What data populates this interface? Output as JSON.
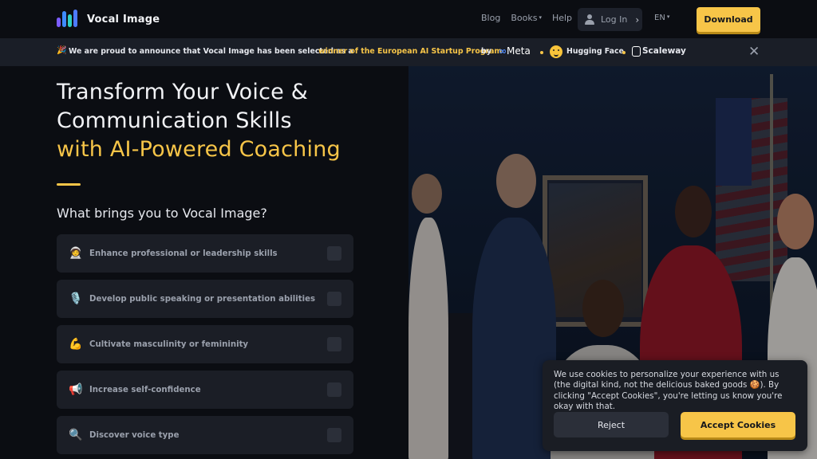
{
  "nav": {
    "logo_text": "Vocal Image",
    "links": [
      {
        "label": "Blog"
      },
      {
        "label": "Books",
        "caret": "▾"
      },
      {
        "label": "Help"
      }
    ],
    "login_label": "Log In",
    "lang_label": "EN",
    "download_label": "Download"
  },
  "banner": {
    "emoji": "🎉",
    "text": "We are proud to announce that Vocal Image has been selected as a",
    "highlight": "winner of the European AI Startup Program",
    "by": "by",
    "partners": [
      "Meta",
      "Hugging Face",
      "Scaleway"
    ],
    "close": "✕"
  },
  "hero": {
    "title_line1": "Transform Your Voice &",
    "title_line2": "Communication Skills",
    "title_line3": "with AI-Powered Coaching",
    "question": "What brings you to Vocal Image?",
    "options": [
      {
        "icon": "🧑‍🚀",
        "label": "Enhance professional or leadership skills"
      },
      {
        "icon": "🎙️",
        "label": "Develop public speaking or presentation abilities"
      },
      {
        "icon": "💪",
        "label": "Cultivate masculinity or femininity"
      },
      {
        "icon": "📢",
        "label": "Increase self-confidence"
      },
      {
        "icon": "🔍",
        "label": "Discover voice type"
      }
    ]
  },
  "cookie": {
    "text": "We use cookies to personalize your experience with us (the digital kind, not the delicious baked goods 🍪). By clicking \"Accept Cookies\", you're letting us know you're okay with that.",
    "reject_label": "Reject",
    "accept_label": "Accept Cookies"
  },
  "colors": {
    "accent": "#f7c548",
    "background": "#0b0d12",
    "card": "#1b1e26",
    "banner": "#1a1e27"
  }
}
